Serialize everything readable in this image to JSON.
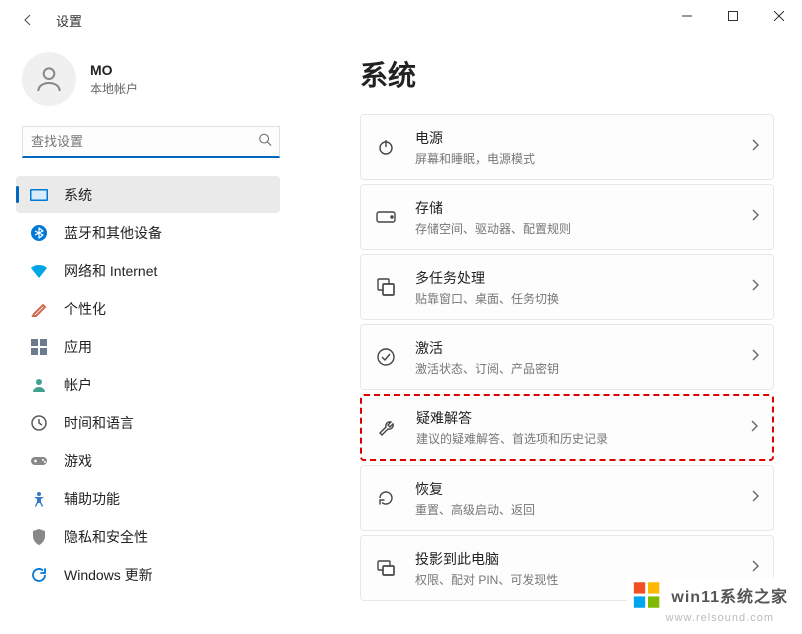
{
  "titlebar": {
    "app_title": "设置"
  },
  "profile": {
    "name": "MO",
    "sub": "本地帐户"
  },
  "search": {
    "placeholder": "查找设置"
  },
  "nav": [
    {
      "id": "system",
      "label": "系统",
      "icon": "system",
      "color": "#0078d4",
      "active": true
    },
    {
      "id": "bluetooth",
      "label": "蓝牙和其他设备",
      "icon": "bluetooth",
      "color": "#0078d4"
    },
    {
      "id": "network",
      "label": "网络和 Internet",
      "icon": "network",
      "color": "#00a5e6"
    },
    {
      "id": "personal",
      "label": "个性化",
      "icon": "personal",
      "color": "#d06a4f"
    },
    {
      "id": "apps",
      "label": "应用",
      "icon": "apps",
      "color": "#6b7a8f"
    },
    {
      "id": "accounts",
      "label": "帐户",
      "icon": "accounts",
      "color": "#3ea28d"
    },
    {
      "id": "time",
      "label": "时间和语言",
      "icon": "time",
      "color": "#5a5a5a"
    },
    {
      "id": "gaming",
      "label": "游戏",
      "icon": "gaming",
      "color": "#888888"
    },
    {
      "id": "accessibility",
      "label": "辅助功能",
      "icon": "accessibility",
      "color": "#3478c6"
    },
    {
      "id": "privacy",
      "label": "隐私和安全性",
      "icon": "privacy",
      "color": "#888888"
    },
    {
      "id": "update",
      "label": "Windows 更新",
      "icon": "update",
      "color": "#0078d4"
    }
  ],
  "page": {
    "title": "系统"
  },
  "cards": [
    {
      "id": "power",
      "title": "电源",
      "sub": "屏幕和睡眠，电源模式",
      "icon": "power"
    },
    {
      "id": "storage",
      "title": "存储",
      "sub": "存储空间、驱动器、配置规则",
      "icon": "storage"
    },
    {
      "id": "multitask",
      "title": "多任务处理",
      "sub": "贴靠窗口、桌面、任务切换",
      "icon": "multitask"
    },
    {
      "id": "activation",
      "title": "激活",
      "sub": "激活状态、订阅、产品密钥",
      "icon": "activation"
    },
    {
      "id": "troubleshoot",
      "title": "疑难解答",
      "sub": "建议的疑难解答、首选项和历史记录",
      "icon": "troubleshoot",
      "highlight": true
    },
    {
      "id": "recovery",
      "title": "恢复",
      "sub": "重置、高级启动、返回",
      "icon": "recovery"
    },
    {
      "id": "project",
      "title": "投影到此电脑",
      "sub": "权限、配对 PIN、可发现性",
      "icon": "project"
    }
  ],
  "watermarks": {
    "text1": "www.relsound.com",
    "text2": "win11系统之家"
  }
}
